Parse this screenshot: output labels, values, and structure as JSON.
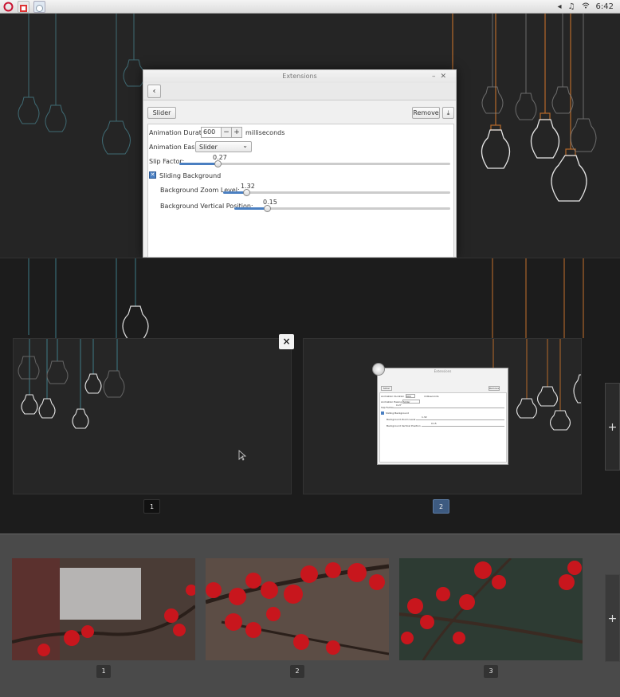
{
  "topbar": {
    "clock": "6:42",
    "tray_icons": [
      "back-arrow-icon",
      "music-icon",
      "wifi-icon"
    ]
  },
  "dialog": {
    "title": "Extensions",
    "extension_name": "Slider",
    "remove_label": "Remove",
    "animation_duration_label": "Animation Duration:",
    "animation_duration_value": "600",
    "duration_unit": "milliseconds",
    "animation_easing_label": "Animation Easing:",
    "animation_easing_value": "Slider",
    "slip_factor_label": "Slip Factor:",
    "slip_factor_value": "0.27",
    "sliding_background_label": "Sliding Background",
    "sliding_background_checked": true,
    "zoom_label": "Background Zoom Level:",
    "zoom_value": "1.32",
    "vertical_label": "Background Vertical Position:",
    "vertical_value": "0.15"
  },
  "slider_levels": {
    "slip_factor": 0.14,
    "zoom": 0.1,
    "vertical": 0.15
  },
  "workspaces": {
    "items": [
      {
        "label": "1",
        "active": false
      },
      {
        "label": "2",
        "active": true
      }
    ],
    "close_label": "×",
    "add_label": "+"
  },
  "preview": {
    "title": "Extensions",
    "ext": "Slider",
    "remove": "Remove",
    "duration_label": "Animation Duration",
    "duration_value": "600",
    "unit": "milliseconds",
    "easing_label": "Animation Easing",
    "easing_value": "Slider",
    "slip_label": "Slip Factor",
    "slip_value": "0.27",
    "bg_label": "Sliding Background",
    "zoom_label": "Background Zoom Level",
    "zoom_value": "1.32",
    "vpos_label": "Background Vertical Position",
    "vpos_value": "0.15"
  },
  "thumbnails": {
    "items": [
      {
        "label": "1"
      },
      {
        "label": "2"
      },
      {
        "label": "3"
      }
    ],
    "add_label": "+"
  },
  "colors": {
    "accent": "#4a7fc1",
    "active_workspace": "#3d5a80",
    "berry_red": "#c8161d"
  }
}
